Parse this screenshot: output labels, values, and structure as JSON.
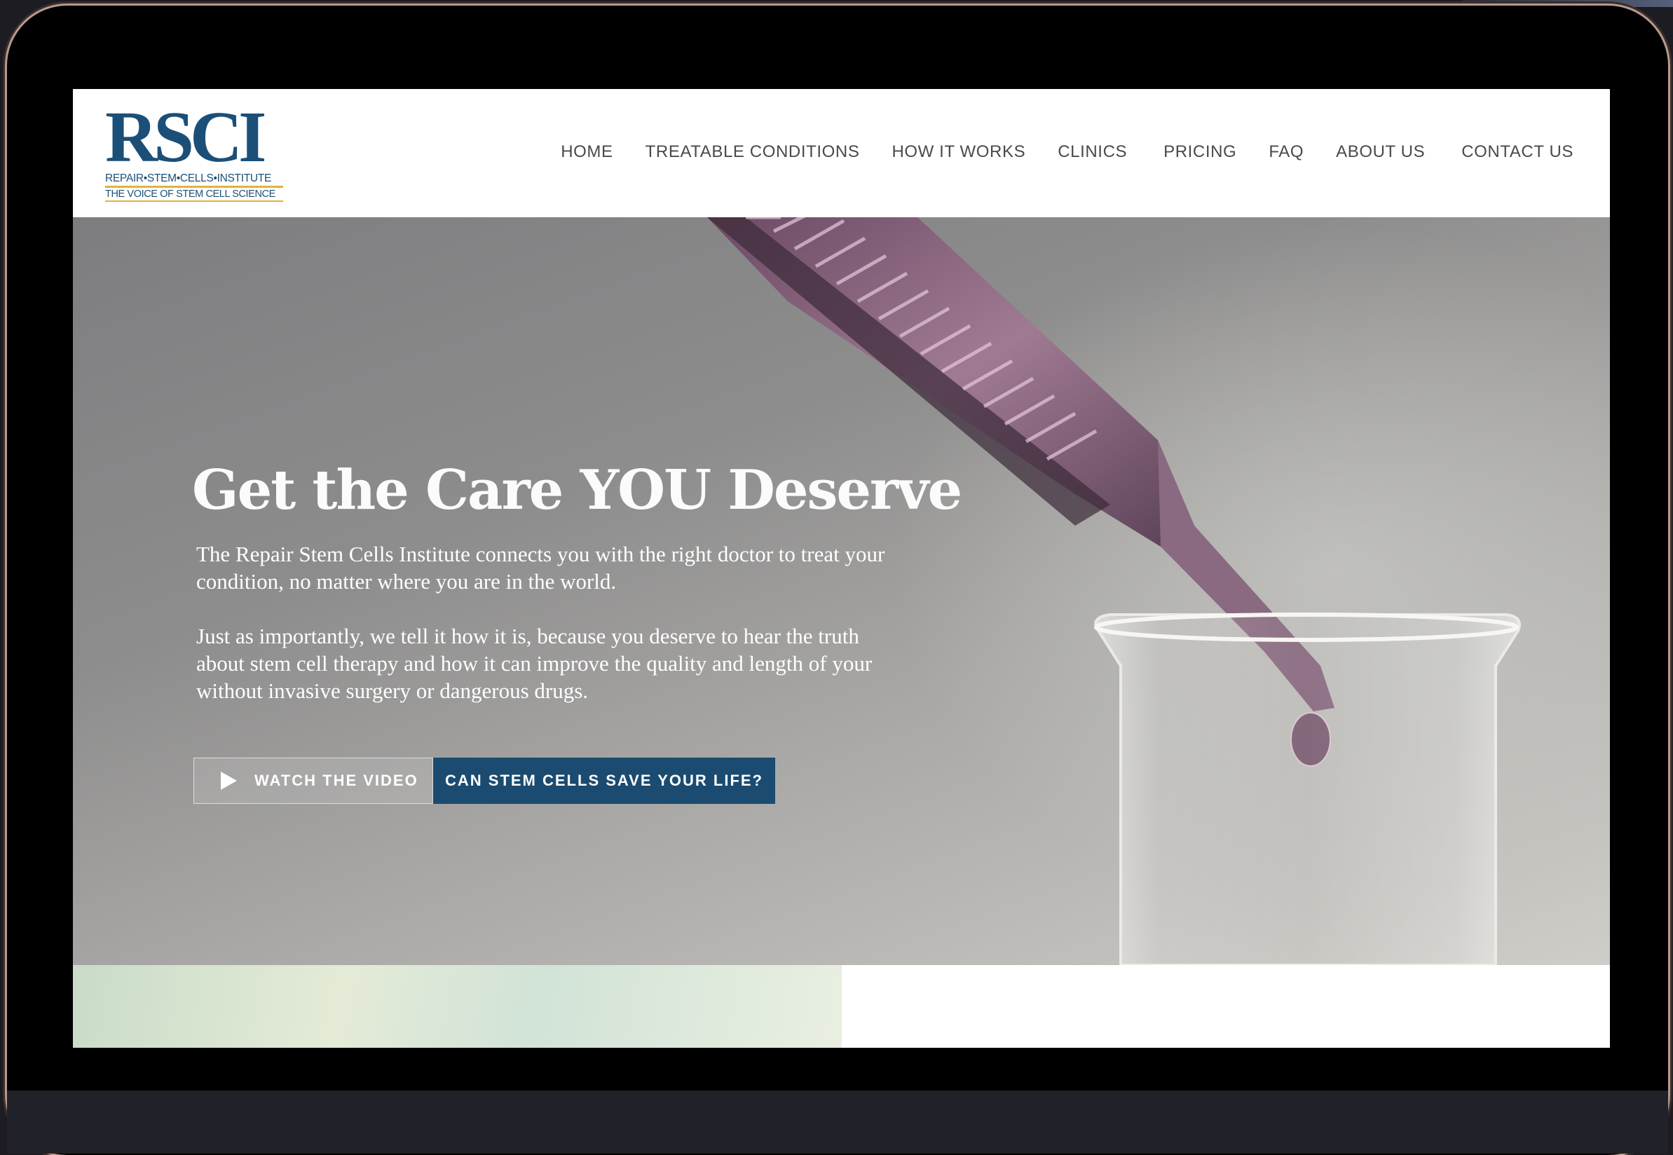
{
  "logo": {
    "mark": "RSCI",
    "line1": "REPAIR•STEM•CELLS•INSTITUTE",
    "line2": "THE VOICE OF STEM CELL SCIENCE"
  },
  "nav": {
    "items": [
      {
        "label": "HOME"
      },
      {
        "label": "TREATABLE CONDITIONS"
      },
      {
        "label": "HOW IT WORKS"
      },
      {
        "label": "CLINICS"
      },
      {
        "label": "PRICING"
      },
      {
        "label": "FAQ"
      },
      {
        "label": "ABOUT US"
      },
      {
        "label": "CONTACT US"
      }
    ]
  },
  "hero": {
    "title": "Get the Care YOU Deserve",
    "paragraph1": "The Repair Stem Cells Institute connects you with the right doctor to treat your condition, no matter where you are in the world.",
    "paragraph2": "Just as importantly, we tell it how it is, because you deserve to hear the truth about stem cell therapy and how it can improve the quality and length of your without invasive surgery or dangerous drugs.",
    "video_button_label": "WATCH THE VIDEO",
    "video_button_icon": "play-icon",
    "cta_button_label": "CAN STEM CELLS SAVE YOUR LIFE?"
  },
  "colors": {
    "brand": "#1b4f78",
    "cta": "#1b4b70",
    "accent_gold": "#e2b23a",
    "nav_text": "#4a4a4a"
  }
}
